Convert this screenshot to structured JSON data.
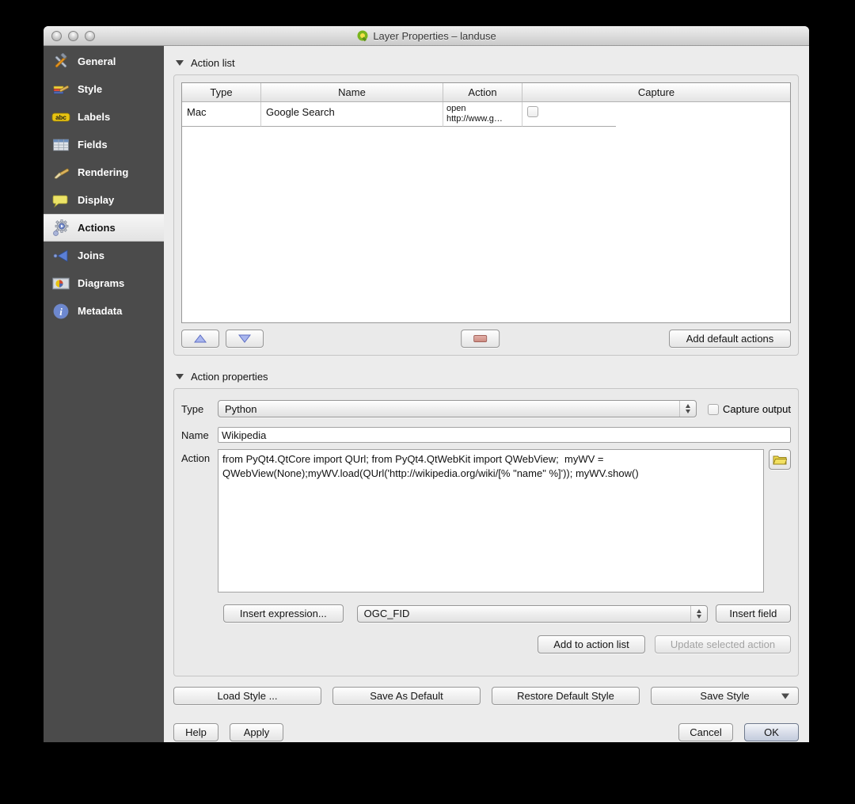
{
  "window": {
    "title": "Layer Properties – landuse",
    "app_icon": "qgis-icon"
  },
  "colors": {
    "sidebar_bg": "#4b4b4b",
    "window_bg": "#ececec",
    "selection_bg": "#ededed"
  },
  "sidebar": {
    "items": [
      {
        "label": "General",
        "icon": "tools-icon",
        "selected": false
      },
      {
        "label": "Style",
        "icon": "style-brush-icon",
        "selected": false
      },
      {
        "label": "Labels",
        "icon": "abc-label-icon",
        "selected": false
      },
      {
        "label": "Fields",
        "icon": "table-icon",
        "selected": false
      },
      {
        "label": "Rendering",
        "icon": "brush-icon",
        "selected": false
      },
      {
        "label": "Display",
        "icon": "speech-bubble-icon",
        "selected": false
      },
      {
        "label": "Actions",
        "icon": "gears-play-icon",
        "selected": true
      },
      {
        "label": "Joins",
        "icon": "join-arrow-icon",
        "selected": false
      },
      {
        "label": "Diagrams",
        "icon": "pie-chart-icon",
        "selected": false
      },
      {
        "label": "Metadata",
        "icon": "info-icon",
        "selected": false
      }
    ]
  },
  "action_list": {
    "header": "Action list",
    "table": {
      "columns": [
        "Type",
        "Name",
        "Action",
        "Capture"
      ],
      "rows": [
        {
          "type": "Mac",
          "name": "Google Search",
          "action": "open\nhttp://www.g…",
          "capture_checked": false
        }
      ]
    },
    "move_up_icon": "up-arrow-icon",
    "move_down_icon": "down-arrow-icon",
    "remove_icon": "remove-icon",
    "add_default_actions_label": "Add default actions"
  },
  "action_properties": {
    "header": "Action properties",
    "type_label": "Type",
    "type_value": "Python",
    "capture_output_label": "Capture output",
    "capture_output_checked": false,
    "name_label": "Name",
    "name_value": "Wikipedia",
    "action_label": "Action",
    "action_value": "from PyQt4.QtCore import QUrl; from PyQt4.QtWebKit import QWebView;  myWV = QWebView(None);myWV.load(QUrl('http://wikipedia.org/wiki/[% \"name\" %]')); myWV.show()",
    "file_button_icon": "folder-icon",
    "insert_expression_label": "Insert expression...",
    "field_value": "OGC_FID",
    "insert_field_label": "Insert field",
    "add_to_action_list_label": "Add to action list",
    "update_selected_action_label": "Update selected action",
    "update_selected_action_enabled": false
  },
  "style_buttons": {
    "load_style": "Load Style ...",
    "save_as_default": "Save As Default",
    "restore_default_style": "Restore Default Style",
    "save_style": "Save Style"
  },
  "footer": {
    "help": "Help",
    "apply": "Apply",
    "cancel": "Cancel",
    "ok": "OK"
  }
}
